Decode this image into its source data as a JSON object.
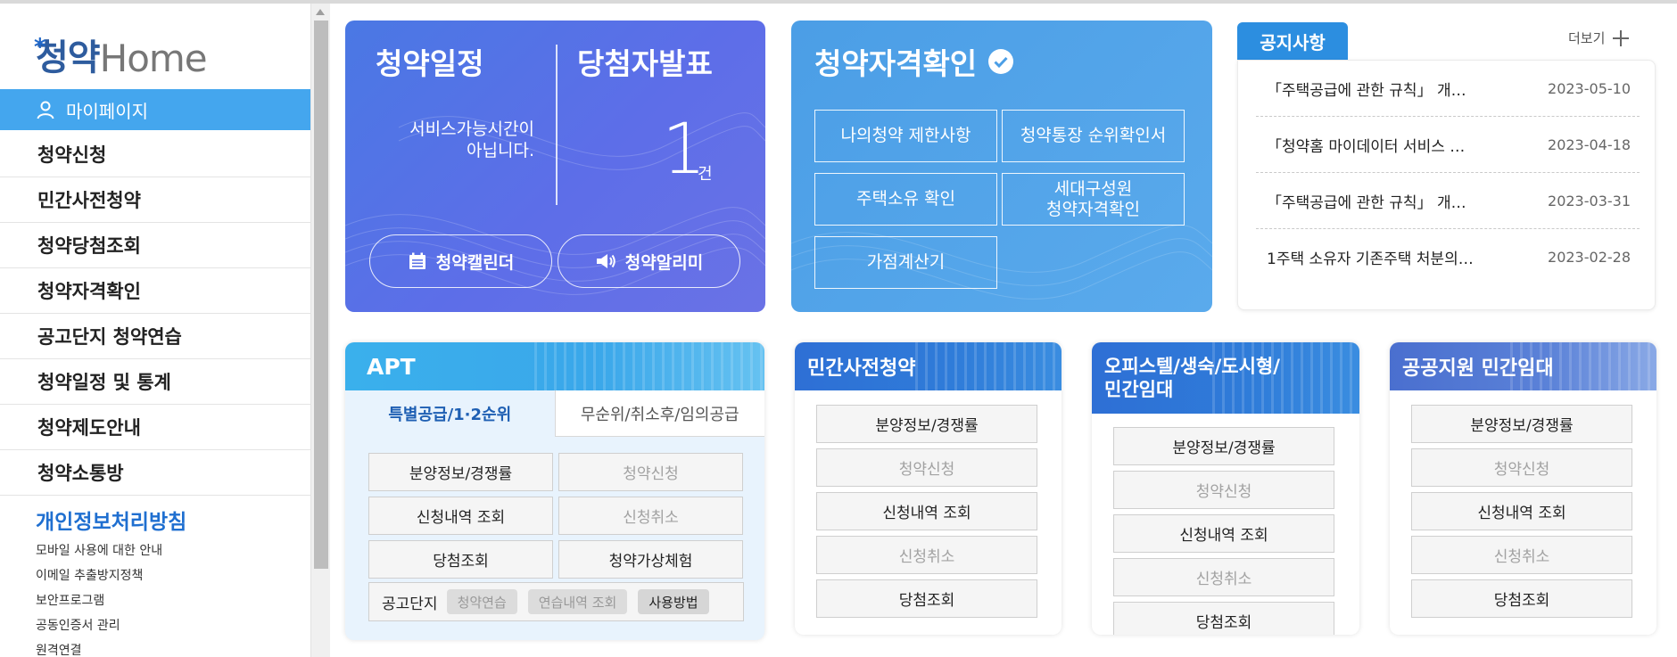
{
  "sidebar": {
    "logo": {
      "main": "청약",
      "sub": "Home"
    },
    "mypage": "마이페이지",
    "menu": [
      "청약신청",
      "민간사전청약",
      "청약당첨조회",
      "청약자격확인",
      "공고단지 청약연습",
      "청약일정 및 통계",
      "청약제도안내",
      "청약소통방"
    ],
    "privacy_title": "개인정보처리방침",
    "links": [
      "모바일 사용에 대한 안내",
      "이메일 추출방지정책",
      "보안프로그램",
      "공동인증서 관리",
      "원격연결"
    ]
  },
  "schedule": {
    "title": "청약일정",
    "message_line1": "서비스가능시간이",
    "message_line2": "아닙니다.",
    "winners_title": "당첨자발표",
    "winners_count": "1",
    "winners_unit": "건",
    "calendar_button": "청약캘린더",
    "alarm_button": "청약알리미"
  },
  "qualification": {
    "title": "청약자격확인",
    "buttons": [
      "나의청약 제한사항",
      "청약통장 순위확인서",
      "주택소유 확인",
      "세대구성원",
      "청약자격확인",
      "가점계산기"
    ]
  },
  "notice": {
    "tab": "공지사항",
    "more": "더보기",
    "items": [
      {
        "title": "「주택공급에 관한 규칙」 개…",
        "date": "2023-05-10"
      },
      {
        "title": "「청약홈 마이데이터 서비스 …",
        "date": "2023-04-18"
      },
      {
        "title": "「주택공급에 관한 규칙」 개…",
        "date": "2023-03-31"
      },
      {
        "title": "1주택 소유자 기존주택 처분의…",
        "date": "2023-02-28"
      }
    ]
  },
  "apt": {
    "title": "APT",
    "tab_active": "특별공급/1·2순위",
    "tab_inactive": "무순위/취소후/임의공급",
    "grid": [
      "분양정보/경쟁률",
      "청약신청",
      "신청내역 조회",
      "신청취소",
      "당첨조회",
      "청약가상체험"
    ],
    "practice_label": "공고단지",
    "practice_chips": [
      "청약연습",
      "연습내역 조회",
      "사용방법"
    ]
  },
  "private_pre": {
    "title": "민간사전청약",
    "buttons": [
      "분양정보/경쟁률",
      "청약신청",
      "신청내역 조회",
      "신청취소",
      "당첨조회"
    ]
  },
  "officetel": {
    "title_line1": "오피스텔/생숙/도시형/",
    "title_line2": "민간임대",
    "buttons": [
      "분양정보/경쟁률",
      "청약신청",
      "신청내역 조회",
      "신청취소",
      "당첨조회"
    ]
  },
  "public_rental": {
    "title": "공공지원 민간임대",
    "buttons": [
      "분양정보/경쟁률",
      "청약신청",
      "신청내역 조회",
      "신청취소",
      "당첨조회"
    ]
  },
  "colors": {
    "accent": "#44a6ee",
    "schedule_card": "#5a72e6",
    "qual_card": "#52a5ea",
    "notice_tab": "#2c8ee0",
    "privacy": "#1f6fd0"
  }
}
